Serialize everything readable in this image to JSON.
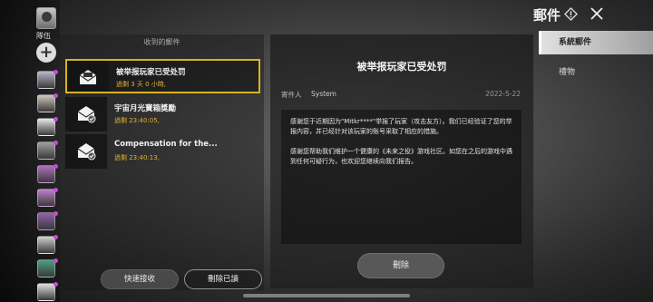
{
  "sidebar": {
    "team_label": "隊伍",
    "add_label": "+",
    "friends": [
      {
        "color": "#b8b8c8",
        "status": "#c04fd0"
      },
      {
        "color": "#d0c8c0",
        "status": "#c04fd0"
      },
      {
        "color": "#e8e8e8",
        "status": "#c04fd0"
      },
      {
        "color": "#a0a0a0",
        "status": "#c04fd0"
      },
      {
        "color": "#b070c0",
        "status": "#c04fd0"
      },
      {
        "color": "#c080d0",
        "status": "#c04fd0"
      },
      {
        "color": "#9060b0",
        "status": "#c04fd0"
      },
      {
        "color": "#d0d0d0",
        "status": "#c04fd0"
      },
      {
        "color": "#50a080",
        "status": "#c04fd0"
      },
      {
        "color": "#e0e0e0",
        "status": "#c04fd0"
      }
    ]
  },
  "header": {
    "title": "郵件"
  },
  "categories": [
    {
      "label": "系統郵件",
      "active": true
    },
    {
      "label": "禮物",
      "active": false
    }
  ],
  "mail_list": {
    "header": "收到的郵件",
    "items": [
      {
        "subject": "被举报玩家已受处罚",
        "expire": "過剩 3 天 0 小時,",
        "selected": true
      },
      {
        "subject": "宇宙月光寶箱獎勵",
        "expire": "過剩 23:40:05,",
        "selected": false
      },
      {
        "subject": "Compensation for the...",
        "expire": "過剩 23:40:13,",
        "selected": false
      }
    ],
    "receive_label": "快速接收",
    "delete_read_label": "刪除已讀"
  },
  "detail": {
    "title": "被举报玩家已受处罚",
    "sender_label": "寄件人",
    "sender": "System",
    "date": "2022-5-22",
    "body": [
      "感谢您于近期因为\"Mitkr****\"举报了玩家（攻击友方）。我们已经验证了您的举报内容，并已经针对该玩家的账号采取了相应的措施。",
      "感谢您帮助我们维护一个健康的《未来之役》游戏社区。如您在之后的游戏中遇到任何可疑行为，也欢迎您继续向我们报告。"
    ],
    "delete_label": "刪除"
  },
  "colors": {
    "selected_border": "#d8b321",
    "expire_text": "#e2b23c"
  }
}
